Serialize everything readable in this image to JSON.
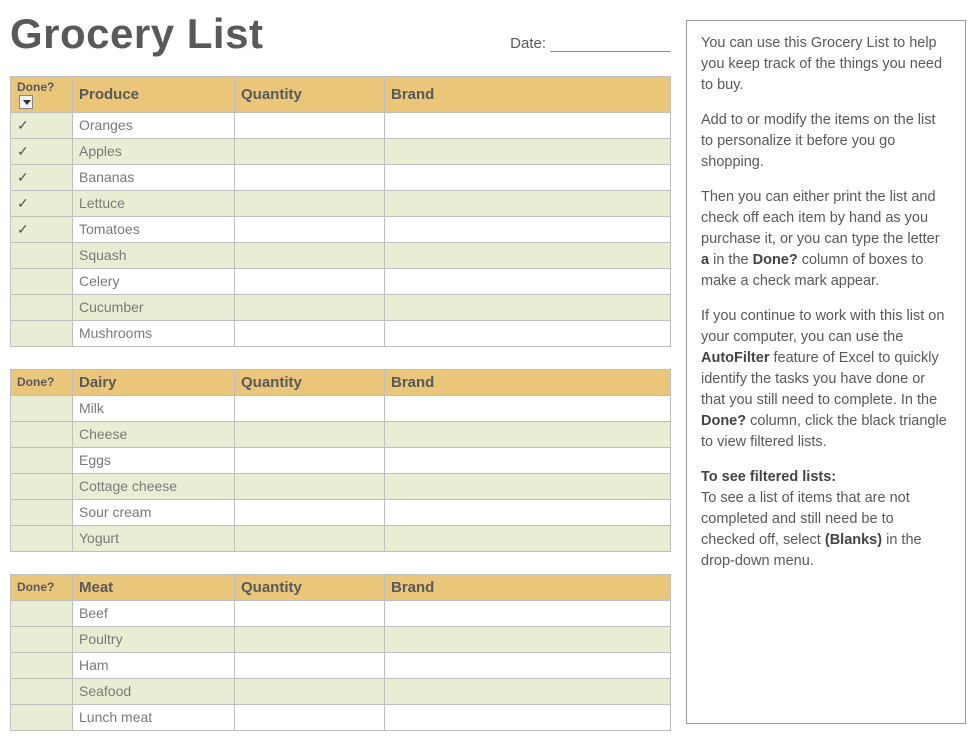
{
  "title": "Grocery List",
  "date_label": "Date:",
  "columns": {
    "done": "Done?",
    "quantity": "Quantity",
    "brand": "Brand"
  },
  "sections": [
    {
      "category": "Produce",
      "has_filter": true,
      "rows": [
        {
          "done": true,
          "item": "Oranges",
          "quantity": "",
          "brand": ""
        },
        {
          "done": true,
          "item": "Apples",
          "quantity": "",
          "brand": ""
        },
        {
          "done": true,
          "item": "Bananas",
          "quantity": "",
          "brand": ""
        },
        {
          "done": true,
          "item": "Lettuce",
          "quantity": "",
          "brand": ""
        },
        {
          "done": true,
          "item": "Tomatoes",
          "quantity": "",
          "brand": ""
        },
        {
          "done": false,
          "item": "Squash",
          "quantity": "",
          "brand": ""
        },
        {
          "done": false,
          "item": "Celery",
          "quantity": "",
          "brand": ""
        },
        {
          "done": false,
          "item": "Cucumber",
          "quantity": "",
          "brand": ""
        },
        {
          "done": false,
          "item": "Mushrooms",
          "quantity": "",
          "brand": ""
        }
      ]
    },
    {
      "category": "Dairy",
      "has_filter": false,
      "rows": [
        {
          "done": false,
          "item": "Milk",
          "quantity": "",
          "brand": ""
        },
        {
          "done": false,
          "item": "Cheese",
          "quantity": "",
          "brand": ""
        },
        {
          "done": false,
          "item": "Eggs",
          "quantity": "",
          "brand": ""
        },
        {
          "done": false,
          "item": "Cottage cheese",
          "quantity": "",
          "brand": ""
        },
        {
          "done": false,
          "item": "Sour cream",
          "quantity": "",
          "brand": ""
        },
        {
          "done": false,
          "item": "Yogurt",
          "quantity": "",
          "brand": ""
        }
      ]
    },
    {
      "category": "Meat",
      "has_filter": false,
      "rows": [
        {
          "done": false,
          "item": "Beef",
          "quantity": "",
          "brand": ""
        },
        {
          "done": false,
          "item": "Poultry",
          "quantity": "",
          "brand": ""
        },
        {
          "done": false,
          "item": "Ham",
          "quantity": "",
          "brand": ""
        },
        {
          "done": false,
          "item": "Seafood",
          "quantity": "",
          "brand": ""
        },
        {
          "done": false,
          "item": "Lunch meat",
          "quantity": "",
          "brand": ""
        }
      ]
    }
  ],
  "help": {
    "p1": "You can use this Grocery List to help you keep track of the things you need to buy.",
    "p2": "Add to or modify the items on the list to personalize it before you go shopping.",
    "p3a": "Then you can either print the list and check off each item by hand as you purchase it, or you can type the letter ",
    "p3b": "a",
    "p3c": " in the ",
    "p3d": "Done?",
    "p3e": " column of boxes to make a check mark appear.",
    "p4a": "If you continue to work with this list on your computer, you can use the ",
    "p4b": "AutoFilter",
    "p4c": " feature of Excel to quickly identify the tasks you have done or that you still need to complete. In the ",
    "p4d": "Done?",
    "p4e": " column, click the black triangle to view filtered lists.",
    "p5a": "To see filtered lists:",
    "p5b": "To see a list of items that are not completed and still need be to checked off, select ",
    "p5c": "(Blanks)",
    "p5d": " in the drop-down menu."
  }
}
